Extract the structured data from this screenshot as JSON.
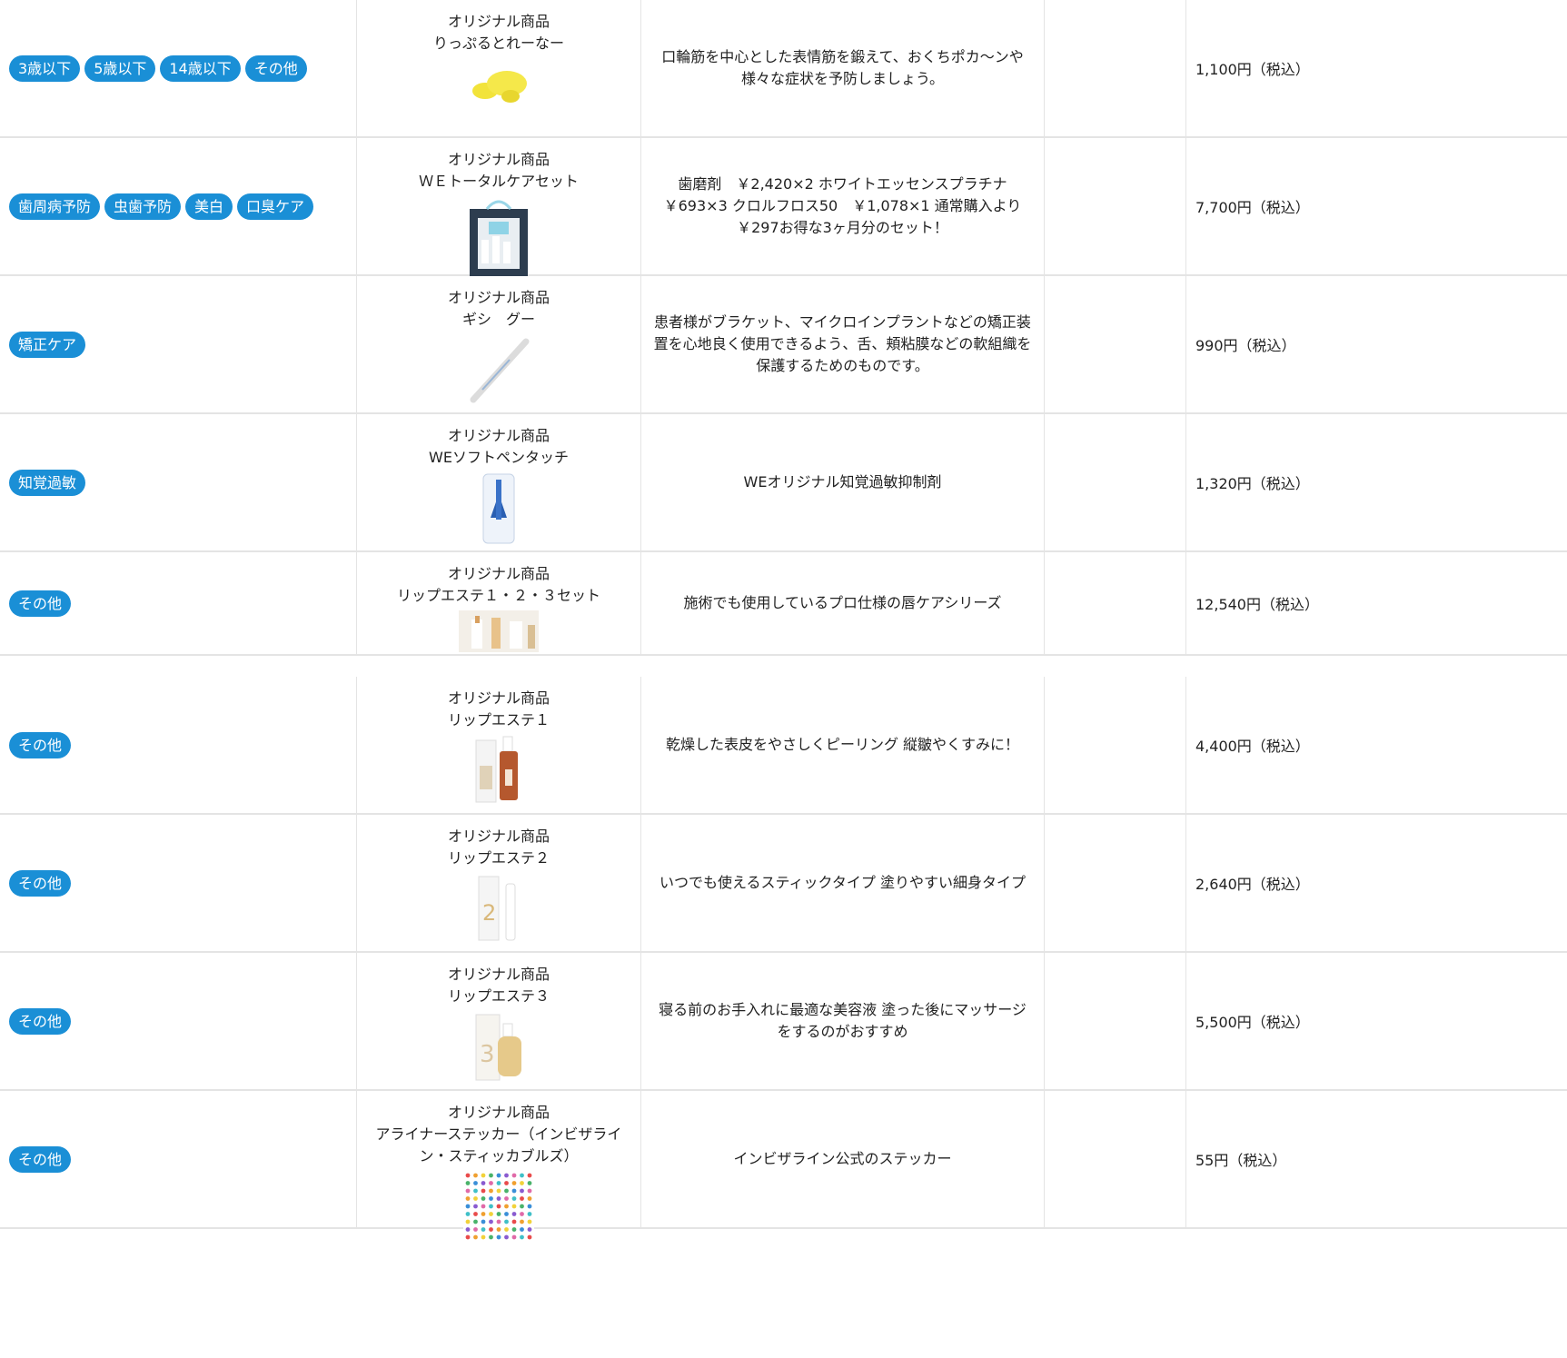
{
  "rows_top": [
    {
      "tags": [
        "3歳以下",
        "5歳以下",
        "14歳以下",
        "その他"
      ],
      "kind": "オリジナル商品",
      "name": "りっぷるとれーなー",
      "image": "yellow-lip-trainer",
      "desc": "口輪筋を中心とした表情筋を鍛えて、おくちポカ〜ンや様々な症状を予防しましょう。",
      "price": "1,100円（税込）"
    },
    {
      "tags": [
        "歯周病予防",
        "虫歯予防",
        "美白",
        "口臭ケア"
      ],
      "kind": "オリジナル商品",
      "name": "ＷＥトータルケアセット",
      "image": "gift-bag-set",
      "desc": "歯磨剤　￥2,420×2 ホワイトエッセンスプラチナ　￥693×3 クロルフロス50　￥1,078×1 通常購入より￥297お得な3ヶ月分のセット！",
      "price": "7,700円（税込）"
    },
    {
      "tags": [
        "矯正ケア"
      ],
      "kind": "オリジナル商品",
      "name": "ギシ　グー",
      "image": "tube-stick",
      "desc": "患者様がブラケット、マイクロインプラントなどの矯正装置を心地良く使用できるよう、舌、頬粘膜などの軟組織を保護するためのものです。",
      "price": "990円（税込）"
    },
    {
      "tags": [
        "知覚過敏"
      ],
      "kind": "オリジナル商品",
      "name": "WEソフトペンタッチ",
      "image": "pen-package",
      "desc": "WEオリジナル知覚過敏抑制剤",
      "price": "1,320円（税込）"
    },
    {
      "tags": [
        "その他"
      ],
      "kind": "オリジナル商品",
      "name": "リップエステ１・２・３セット",
      "image": "lip-set",
      "desc": "施術でも使用しているプロ仕様の唇ケアシリーズ",
      "price": "12,540円（税込）"
    }
  ],
  "rows_bottom": [
    {
      "tags": [
        "その他"
      ],
      "kind": "オリジナル商品",
      "name": "リップエステ１",
      "image": "serum-bottle",
      "desc": "乾燥した表皮をやさしくピーリング 縦皺やくすみに！",
      "price": "4,400円（税込）"
    },
    {
      "tags": [
        "その他"
      ],
      "kind": "オリジナル商品",
      "name": "リップエステ２",
      "image": "lip-stick",
      "desc": "いつでも使えるスティックタイプ 塗りやすい細身タイプ",
      "price": "2,640円（税込）"
    },
    {
      "tags": [
        "その他"
      ],
      "kind": "オリジナル商品",
      "name": "リップエステ３",
      "image": "essence-bottle",
      "desc": "寝る前のお手入れに最適な美容液 塗った後にマッサージをするのがおすすめ",
      "price": "5,500円（税込）"
    },
    {
      "tags": [
        "その他"
      ],
      "kind": "オリジナル商品",
      "name": "アライナーステッカー（インビザライン・スティッカブルズ）",
      "image": "sticker-sheet",
      "desc": "インビザライン公式のステッカー",
      "price": "55円（税込）"
    }
  ]
}
